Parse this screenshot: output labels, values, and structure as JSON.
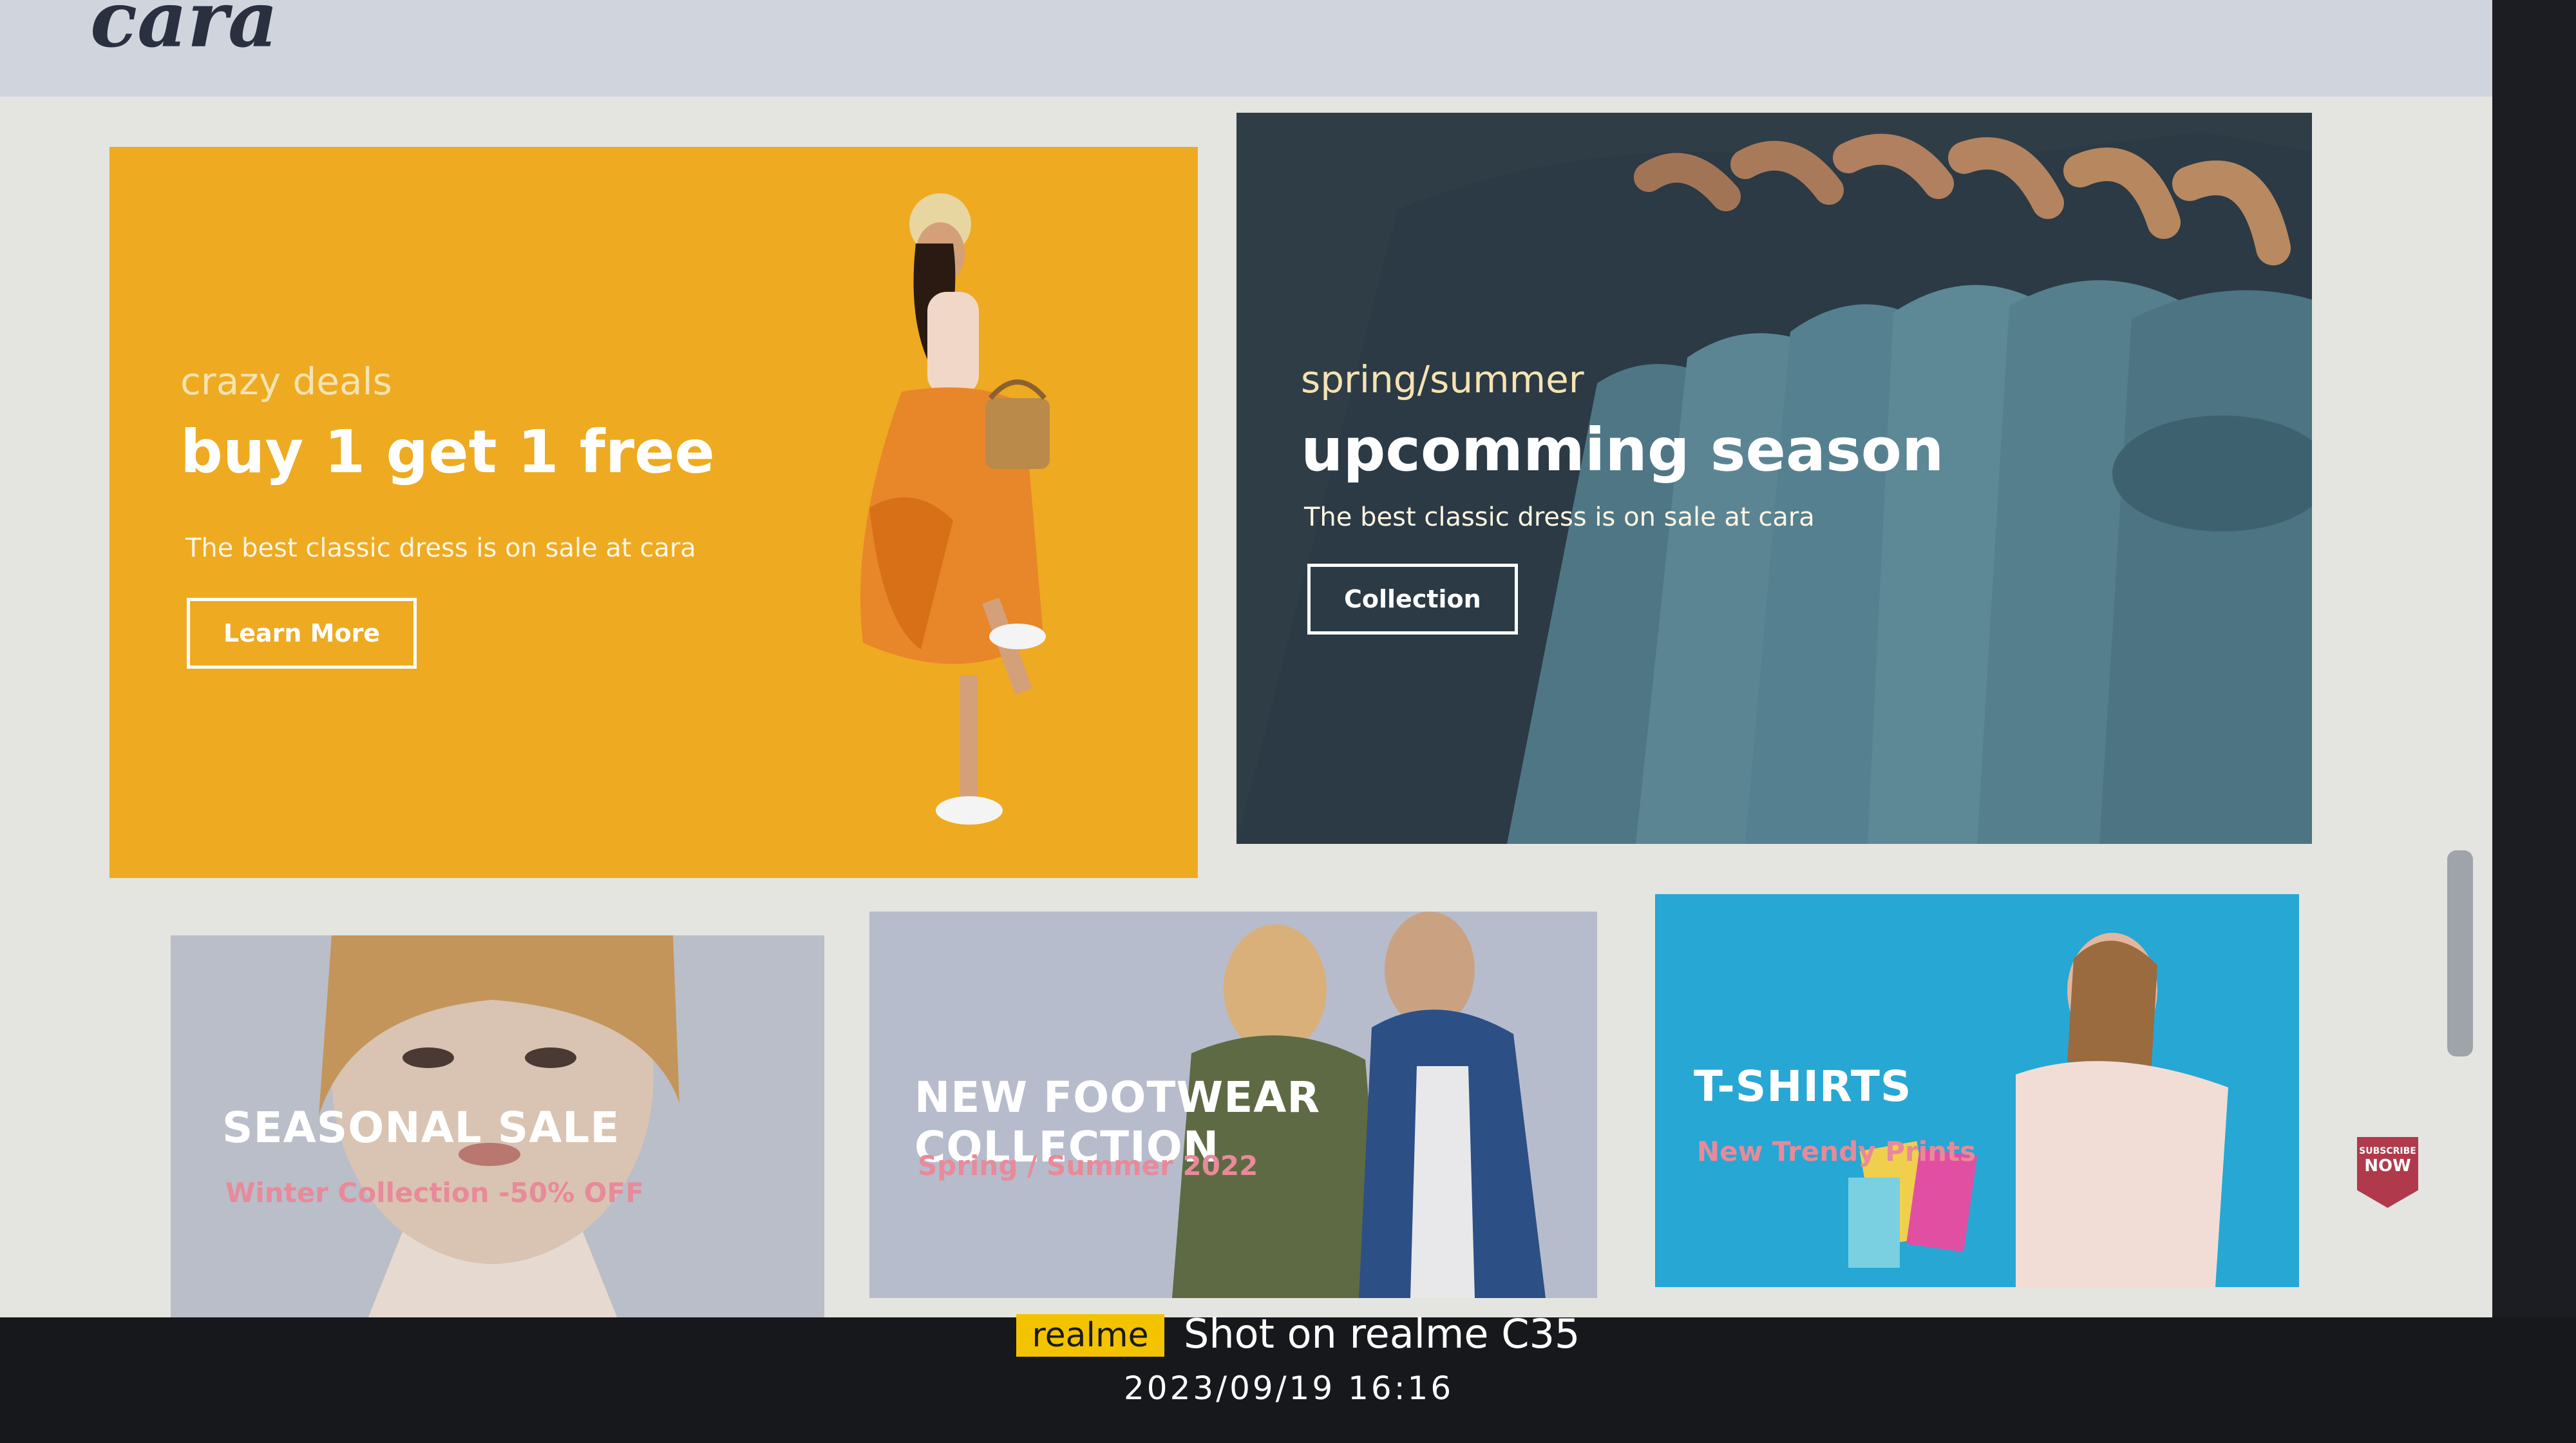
{
  "header": {
    "logo": "cara"
  },
  "banners": [
    {
      "eyebrow": "crazy deals",
      "title": "buy 1 get 1 free",
      "description": "The best classic dress is on sale at cara",
      "button": "Learn More"
    },
    {
      "eyebrow": "spring/summer",
      "title": "upcomming season",
      "description": "The best classic dress is on sale at cara",
      "button": "Collection"
    }
  ],
  "cards": [
    {
      "title": "SEASONAL SALE",
      "subtitle": "Winter Collection -50% OFF"
    },
    {
      "title": "NEW FOOTWEAR COLLECTION",
      "subtitle": "Spring / Summer 2022"
    },
    {
      "title": "T-SHIRTS",
      "subtitle": "New Trendy Prints"
    }
  ],
  "subscribe_badge": {
    "top": "SUBSCRIBE",
    "main": "NOW"
  },
  "camera_watermark": {
    "brand": "realme",
    "text": "Shot on realme C35",
    "datetime": "2023/09/19  16:16"
  }
}
